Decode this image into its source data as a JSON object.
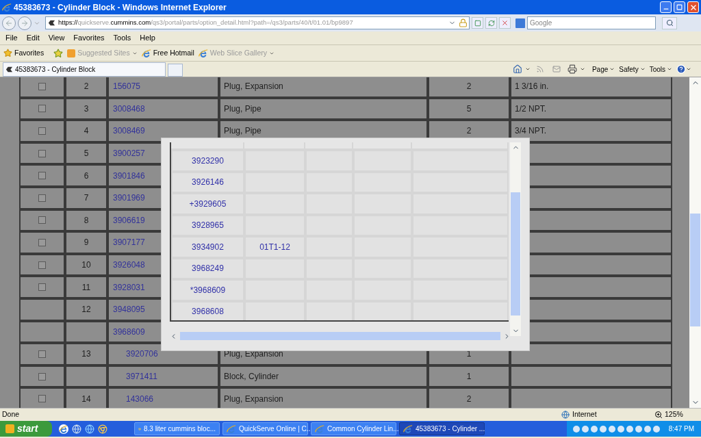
{
  "window": {
    "title": "45383673 - Cylinder Block - Windows Internet Explorer"
  },
  "address": {
    "url_parts": [
      {
        "text": "https://",
        "emphasis": true
      },
      {
        "text": "quickserve.",
        "emphasis": false
      },
      {
        "text": "cummins.com",
        "emphasis": true
      },
      {
        "text": "/qs3/portal/parts/option_detail.html?path=/qs3/parts/40/t/01.01/bp9897",
        "emphasis": false
      }
    ]
  },
  "search": {
    "placeholder": "Google"
  },
  "menu": [
    "File",
    "Edit",
    "View",
    "Favorites",
    "Tools",
    "Help"
  ],
  "favorites_bar": [
    {
      "label": "Favorites",
      "disabled": false,
      "dropdown": false
    },
    {
      "label": "Suggested Sites",
      "disabled": true,
      "dropdown": true
    },
    {
      "label": "Free Hotmail",
      "disabled": false,
      "dropdown": false
    },
    {
      "label": "Web Slice Gallery",
      "disabled": true,
      "dropdown": true
    }
  ],
  "tab": {
    "label": "45383673 - Cylinder Block"
  },
  "command_bar": [
    "Page",
    "Safety",
    "Tools"
  ],
  "parts_table": {
    "rows": [
      {
        "checkbox": {
          "checked": false
        },
        "number": "2",
        "part": "156075",
        "description": "Plug, Expansion",
        "quantity": "2",
        "notes": "1 3/16 in."
      },
      {
        "checkbox": {
          "checked": false
        },
        "number": "3",
        "part": "3008468",
        "description": "Plug, Pipe",
        "quantity": "5",
        "notes": "1/2 NPT."
      },
      {
        "checkbox": {
          "checked": false
        },
        "number": "4",
        "part": "3008469",
        "description": "Plug, Pipe",
        "quantity": "2",
        "notes": "3/4 NPT."
      },
      {
        "checkbox": {
          "checked": false
        },
        "number": "5",
        "part": "3900257"
      },
      {
        "checkbox": {
          "checked": false
        },
        "number": "6",
        "part": "3901846"
      },
      {
        "checkbox": {
          "checked": false
        },
        "number": "7",
        "part": "3901969"
      },
      {
        "checkbox": {
          "checked": false
        },
        "number": "8",
        "part": "3906619"
      },
      {
        "checkbox": {
          "checked": false
        },
        "number": "9",
        "part": "3907177"
      },
      {
        "checkbox": {
          "checked": false
        },
        "number": "10",
        "part": "3926048"
      },
      {
        "checkbox": {
          "checked": false
        },
        "number": "11",
        "part": "3928031"
      },
      {
        "number": "12",
        "part": "3948095"
      },
      {
        "part": "3968609"
      },
      {
        "checkbox": {
          "checked": false
        },
        "number": "13",
        "part": "3920706",
        "description": "Plug, Expansion",
        "quantity": "1"
      },
      {
        "checkbox": {
          "checked": false
        },
        "part": "3971411",
        "description": "Block, Cylinder",
        "quantity": "1"
      },
      {
        "checkbox": {
          "checked": false
        },
        "number": "14",
        "part": "143066",
        "description": "Plug, Expansion",
        "quantity": "2"
      }
    ]
  },
  "popup": {
    "rows": [
      {
        "column_1": "3923290"
      },
      {
        "column_1": "3926146"
      },
      {
        "column_1": "+3929605"
      },
      {
        "column_1": "3928965"
      },
      {
        "column_1": "3934902",
        "column_2": "01T1-12"
      },
      {
        "column_1": "3968249"
      },
      {
        "column_1": "*3968609"
      },
      {
        "column_1": "3968608"
      }
    ]
  },
  "status_bar": {
    "text": "Done",
    "zone": "Internet",
    "zoom": "125%"
  },
  "taskbar": {
    "start": "start",
    "tasks": [
      {
        "label": "8.3 liter cummins bloc...",
        "selected": false
      },
      {
        "label": "QuickServe Online | C...",
        "selected": false
      },
      {
        "label": "Common Cylinder Lin...",
        "selected": false
      },
      {
        "label": "45383673 - Cylinder ...",
        "selected": true
      }
    ],
    "clock": "8:47 PM"
  }
}
